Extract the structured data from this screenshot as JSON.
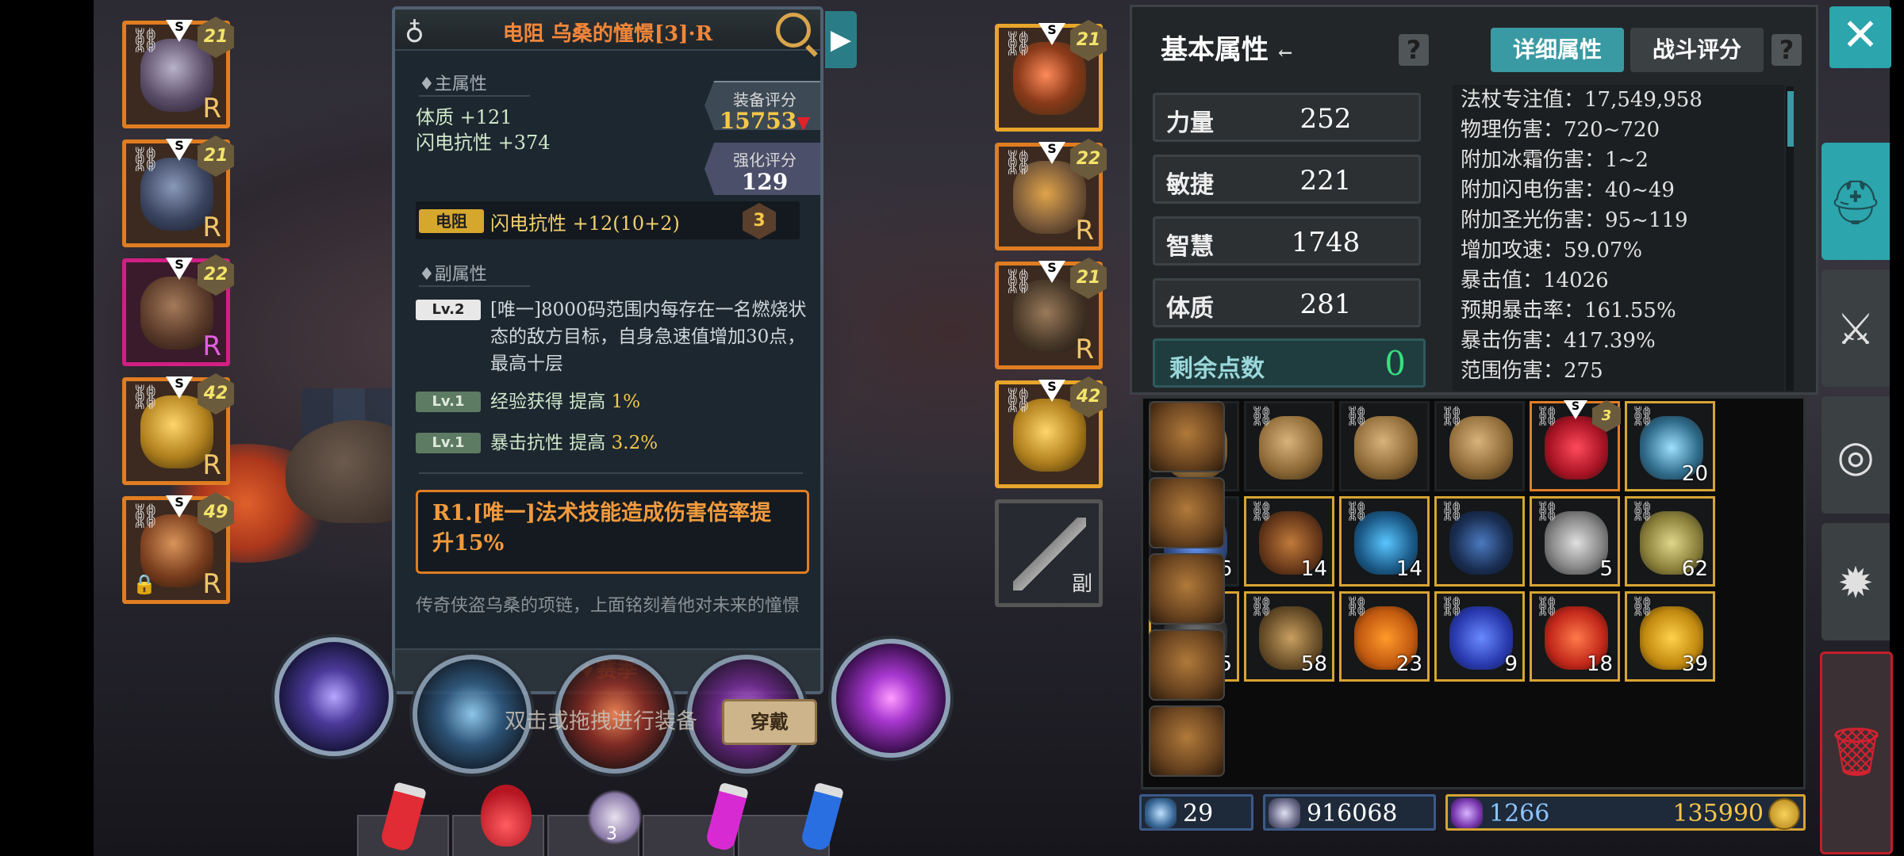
{
  "equip_left": [
    {
      "level": "21",
      "rarity": "R",
      "frame": "orange",
      "name": "hood-helmet-item"
    },
    {
      "level": "21",
      "rarity": "R",
      "frame": "orange",
      "name": "armor-item"
    },
    {
      "level": "22",
      "rarity": "R",
      "frame": "purple",
      "name": "cape-item"
    },
    {
      "level": "42",
      "rarity": "R",
      "frame": "orange",
      "name": "ring-item"
    },
    {
      "level": "49",
      "rarity": "R",
      "frame": "orange",
      "name": "claw-item"
    }
  ],
  "equip_right": [
    {
      "level": "21",
      "rarity": "",
      "frame": "gold",
      "name": "necklace-item"
    },
    {
      "level": "22",
      "rarity": "R",
      "frame": "orange",
      "name": "gloves-item"
    },
    {
      "level": "21",
      "rarity": "R",
      "frame": "orange",
      "name": "boots-item"
    },
    {
      "level": "42",
      "rarity": "",
      "frame": "gold",
      "name": "ring2-item"
    }
  ],
  "slot_offhand_label": "副",
  "grade_mark": "S",
  "tooltip": {
    "title": "电阻 乌桑的憧憬[3]·R",
    "main_section": "♦主属性",
    "main_attrs": [
      "体质 +121",
      "闪电抗性 +374"
    ],
    "score_label": "装备评分",
    "score_value": "15753",
    "enhance_label": "强化评分",
    "enhance_value": "129",
    "enhance_tag": "电阻",
    "enhance_text": "闪电抗性 +12(10+2)",
    "enhance_level": "3",
    "sub_section": "♦副属性",
    "sub_attrs": [
      {
        "lv": "Lv.2",
        "text": "[唯一]8000码范围内每存在一名燃烧状态的敌方目标，自身急速值增加30点，最高十层",
        "hi": ""
      },
      {
        "lv": "Lv.1",
        "text": "经验获得 提高 ",
        "hi": "1%"
      },
      {
        "lv": "Lv.1",
        "text": "暴击抗性 提高 ",
        "hi": "3.2%"
      }
    ],
    "unique_text": "R1.[唯一]法术技能造成伤害倍率提升15%",
    "lore": "传奇侠盗乌桑的项链，上面铭刻着他对未来的憧憬",
    "season": "♦赛季"
  },
  "hint": "双击或拖拽进行装备",
  "equip_button": "穿戴",
  "potion_count": "3",
  "stats": {
    "title": "基本属性",
    "title_arrow": "←",
    "tab_detail": "详细属性",
    "tab_battle": "战斗评分",
    "attrs": [
      {
        "name": "力量",
        "value": "252"
      },
      {
        "name": "敏捷",
        "value": "221"
      },
      {
        "name": "智慧",
        "value": "1748"
      },
      {
        "name": "体质",
        "value": "281"
      }
    ],
    "remain_label": "剩余点数",
    "remain_value": "0",
    "details": [
      "法杖专注值：17,549,958",
      "物理伤害：720~720",
      "附加冰霜伤害：1~2",
      "附加闪电伤害：40~49",
      "附加圣光伤害：95~119",
      "增加攻速：59.07%",
      "暴击值：14026",
      "预期暴击率：161.55%",
      "暴击伤害：417.39%",
      "范围伤害：275"
    ]
  },
  "bag": {
    "row1": [
      {
        "art": "pack",
        "count": "",
        "frame": ""
      },
      {
        "art": "pack",
        "count": "",
        "frame": ""
      },
      {
        "art": "pack",
        "count": "",
        "frame": ""
      },
      {
        "art": "pack",
        "count": "",
        "frame": ""
      },
      {
        "art": "neck",
        "count": "",
        "frame": "org",
        "level": "3"
      },
      {
        "art": "scroll",
        "count": "20",
        "frame": "gld"
      }
    ],
    "row2": [
      {
        "art": "crys",
        "count": "26",
        "frame": ""
      },
      {
        "art": "lion",
        "count": "14",
        "frame": "gld"
      },
      {
        "art": "jar",
        "count": "14",
        "frame": "gld"
      },
      {
        "art": "flask",
        "count": "",
        "frame": "gld"
      },
      {
        "art": "skull",
        "count": "5",
        "frame": "gld"
      },
      {
        "art": "bottle",
        "count": "62",
        "frame": "gld"
      }
    ],
    "row3": [
      {
        "art": "ore",
        "count": "45",
        "frame": "gld"
      },
      {
        "art": "ham",
        "count": "58",
        "frame": "gld"
      },
      {
        "art": "fruit",
        "count": "23",
        "frame": "gld"
      },
      {
        "art": "blue",
        "count": "9",
        "frame": "gld"
      },
      {
        "art": "red",
        "count": "18",
        "frame": "gld"
      },
      {
        "art": "gold",
        "count": "39",
        "frame": "gld"
      }
    ]
  },
  "currency": {
    "keys": "29",
    "shards": "916068",
    "gems": "1266",
    "gold": "135990"
  },
  "icons": {
    "close": "✕",
    "helmet": "helmet-icon",
    "weapons": "crossed-swords-icon",
    "portal": "portal-icon",
    "gear": "gear-icon",
    "trash": "trash-icon"
  }
}
